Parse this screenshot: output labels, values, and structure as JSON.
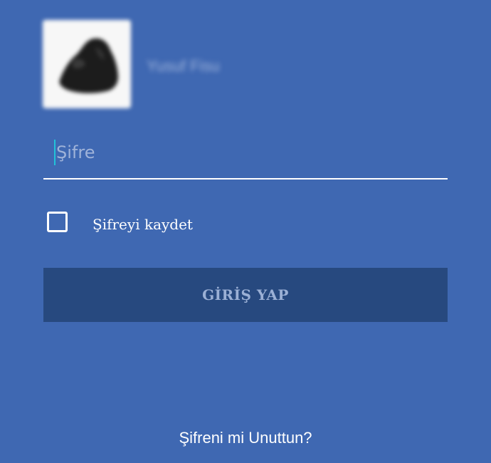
{
  "profile": {
    "avatar_icon": "profile-photo",
    "username": "Yusuf Fisu"
  },
  "login_form": {
    "password_placeholder": "Şifre",
    "password_value": "",
    "remember_label": "Şifreyi kaydet",
    "remember_checked": false,
    "login_button_label": "GİRİŞ YAP",
    "forgot_link_label": "Şifreni mi Unuttun?"
  },
  "colors": {
    "background": "#3f68b2",
    "button_background": "#27497f",
    "button_text": "#9bb0d5",
    "cursor": "#22c3d9",
    "text": "#ffffff"
  }
}
